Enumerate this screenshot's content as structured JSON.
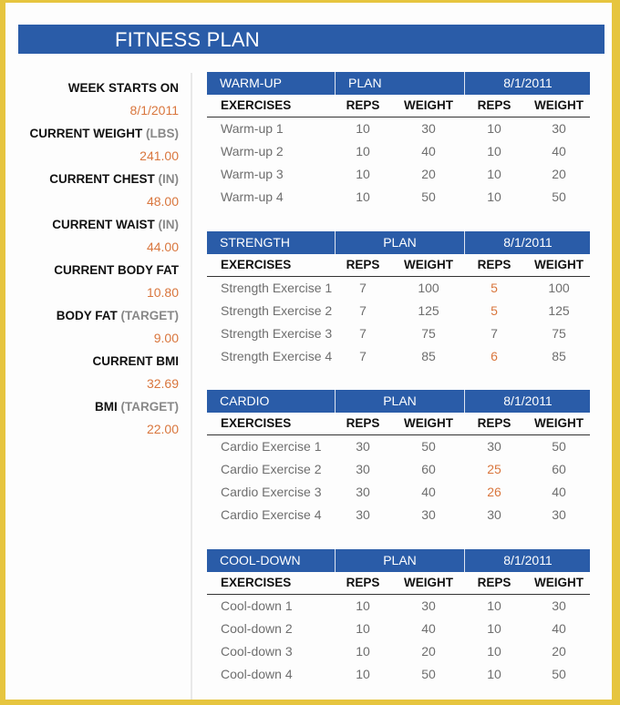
{
  "title": "FITNESS PLAN",
  "stats": [
    {
      "label": "WEEK STARTS ON",
      "unit": "",
      "value": "8/1/2011"
    },
    {
      "label": "CURRENT WEIGHT",
      "unit": "(LBS)",
      "value": "241.00"
    },
    {
      "label": "CURRENT CHEST",
      "unit": "(IN)",
      "value": "48.00"
    },
    {
      "label": "CURRENT WAIST",
      "unit": "(IN)",
      "value": "44.00"
    },
    {
      "label": "CURRENT BODY FAT",
      "unit": "",
      "value": "10.80"
    },
    {
      "label": "BODY FAT",
      "unit": "(TARGET)",
      "value": "9.00"
    },
    {
      "label": "CURRENT BMI",
      "unit": "",
      "value": "32.69"
    },
    {
      "label": "BMI",
      "unit": "(TARGET)",
      "value": "22.00"
    }
  ],
  "columns": {
    "exercises": "EXERCISES",
    "reps": "REPS",
    "weight": "WEIGHT"
  },
  "colors": {
    "header_blue": "#2a5ca8",
    "highlight_orange": "#d9763d",
    "frame_yellow": "#e6c53f"
  },
  "sections": [
    {
      "name": "WARM-UP",
      "plan_label": "PLAN",
      "date": "8/1/2011",
      "rows": [
        {
          "exercise": "Warm-up 1",
          "plan_reps": "10",
          "plan_weight": "30",
          "reps": "10",
          "weight": "30",
          "reps_changed": false
        },
        {
          "exercise": "Warm-up 2",
          "plan_reps": "10",
          "plan_weight": "40",
          "reps": "10",
          "weight": "40",
          "reps_changed": false
        },
        {
          "exercise": "Warm-up 3",
          "plan_reps": "10",
          "plan_weight": "20",
          "reps": "10",
          "weight": "20",
          "reps_changed": false
        },
        {
          "exercise": "Warm-up 4",
          "plan_reps": "10",
          "plan_weight": "50",
          "reps": "10",
          "weight": "50",
          "reps_changed": false
        }
      ]
    },
    {
      "name": "STRENGTH",
      "plan_label": "PLAN",
      "date": "8/1/2011",
      "rows": [
        {
          "exercise": "Strength Exercise 1",
          "plan_reps": "7",
          "plan_weight": "100",
          "reps": "5",
          "weight": "100",
          "reps_changed": true
        },
        {
          "exercise": "Strength Exercise 2",
          "plan_reps": "7",
          "plan_weight": "125",
          "reps": "5",
          "weight": "125",
          "reps_changed": true
        },
        {
          "exercise": "Strength Exercise 3",
          "plan_reps": "7",
          "plan_weight": "75",
          "reps": "7",
          "weight": "75",
          "reps_changed": false
        },
        {
          "exercise": "Strength Exercise 4",
          "plan_reps": "7",
          "plan_weight": "85",
          "reps": "6",
          "weight": "85",
          "reps_changed": true
        }
      ]
    },
    {
      "name": "CARDIO",
      "plan_label": "PLAN",
      "date": "8/1/2011",
      "rows": [
        {
          "exercise": "Cardio Exercise 1",
          "plan_reps": "30",
          "plan_weight": "50",
          "reps": "30",
          "weight": "50",
          "reps_changed": false
        },
        {
          "exercise": "Cardio Exercise 2",
          "plan_reps": "30",
          "plan_weight": "60",
          "reps": "25",
          "weight": "60",
          "reps_changed": true
        },
        {
          "exercise": "Cardio Exercise 3",
          "plan_reps": "30",
          "plan_weight": "40",
          "reps": "26",
          "weight": "40",
          "reps_changed": true
        },
        {
          "exercise": "Cardio Exercise 4",
          "plan_reps": "30",
          "plan_weight": "30",
          "reps": "30",
          "weight": "30",
          "reps_changed": false
        }
      ]
    },
    {
      "name": "COOL-DOWN",
      "plan_label": "PLAN",
      "date": "8/1/2011",
      "rows": [
        {
          "exercise": "Cool-down 1",
          "plan_reps": "10",
          "plan_weight": "30",
          "reps": "10",
          "weight": "30",
          "reps_changed": false
        },
        {
          "exercise": "Cool-down 2",
          "plan_reps": "10",
          "plan_weight": "40",
          "reps": "10",
          "weight": "40",
          "reps_changed": false
        },
        {
          "exercise": "Cool-down 3",
          "plan_reps": "10",
          "plan_weight": "20",
          "reps": "10",
          "weight": "20",
          "reps_changed": false
        },
        {
          "exercise": "Cool-down 4",
          "plan_reps": "10",
          "plan_weight": "50",
          "reps": "10",
          "weight": "50",
          "reps_changed": false
        }
      ]
    }
  ]
}
